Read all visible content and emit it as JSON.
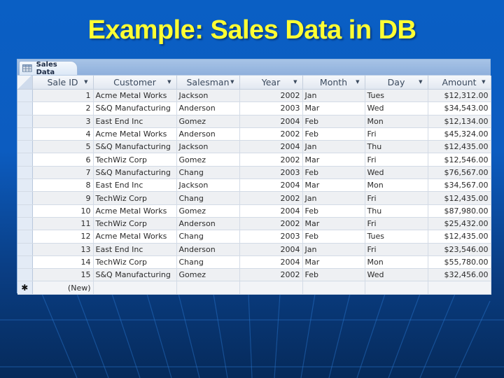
{
  "slide": {
    "title": "Example: Sales Data in DB"
  },
  "window": {
    "tab_label": "Sales Data",
    "tab_icon": "table-icon"
  },
  "table": {
    "columns": [
      {
        "label": "Sale ID"
      },
      {
        "label": "Customer"
      },
      {
        "label": "Salesman"
      },
      {
        "label": "Year"
      },
      {
        "label": "Month"
      },
      {
        "label": "Day"
      },
      {
        "label": "Amount"
      }
    ],
    "rows": [
      {
        "sale_id": "1",
        "customer": "Acme Metal Works",
        "salesman": "Jackson",
        "year": "2002",
        "month": "Jan",
        "day": "Tues",
        "amount": "$12,312.00"
      },
      {
        "sale_id": "2",
        "customer": "S&Q Manufacturing",
        "salesman": "Anderson",
        "year": "2003",
        "month": "Mar",
        "day": "Wed",
        "amount": "$34,543.00"
      },
      {
        "sale_id": "3",
        "customer": "East End Inc",
        "salesman": "Gomez",
        "year": "2004",
        "month": "Feb",
        "day": "Mon",
        "amount": "$12,134.00"
      },
      {
        "sale_id": "4",
        "customer": "Acme Metal Works",
        "salesman": "Anderson",
        "year": "2002",
        "month": "Feb",
        "day": "Fri",
        "amount": "$45,324.00"
      },
      {
        "sale_id": "5",
        "customer": "S&Q Manufacturing",
        "salesman": "Jackson",
        "year": "2004",
        "month": "Jan",
        "day": "Thu",
        "amount": "$12,435.00"
      },
      {
        "sale_id": "6",
        "customer": "TechWiz Corp",
        "salesman": "Gomez",
        "year": "2002",
        "month": "Mar",
        "day": "Fri",
        "amount": "$12,546.00"
      },
      {
        "sale_id": "7",
        "customer": "S&Q Manufacturing",
        "salesman": "Chang",
        "year": "2003",
        "month": "Feb",
        "day": "Wed",
        "amount": "$76,567.00"
      },
      {
        "sale_id": "8",
        "customer": "East End Inc",
        "salesman": "Jackson",
        "year": "2004",
        "month": "Mar",
        "day": "Mon",
        "amount": "$34,567.00"
      },
      {
        "sale_id": "9",
        "customer": "TechWiz Corp",
        "salesman": "Chang",
        "year": "2002",
        "month": "Jan",
        "day": "Fri",
        "amount": "$12,435.00"
      },
      {
        "sale_id": "10",
        "customer": "Acme Metal Works",
        "salesman": "Gomez",
        "year": "2004",
        "month": "Feb",
        "day": "Thu",
        "amount": "$87,980.00"
      },
      {
        "sale_id": "11",
        "customer": "TechWiz Corp",
        "salesman": "Anderson",
        "year": "2002",
        "month": "Mar",
        "day": "Fri",
        "amount": "$25,432.00"
      },
      {
        "sale_id": "12",
        "customer": "Acme Metal Works",
        "salesman": "Chang",
        "year": "2003",
        "month": "Feb",
        "day": "Tues",
        "amount": "$12,435.00"
      },
      {
        "sale_id": "13",
        "customer": "East End Inc",
        "salesman": "Anderson",
        "year": "2004",
        "month": "Jan",
        "day": "Fri",
        "amount": "$23,546.00"
      },
      {
        "sale_id": "14",
        "customer": "TechWiz Corp",
        "salesman": "Chang",
        "year": "2004",
        "month": "Mar",
        "day": "Mon",
        "amount": "$55,780.00"
      },
      {
        "sale_id": "15",
        "customer": "S&Q Manufacturing",
        "salesman": "Gomez",
        "year": "2002",
        "month": "Feb",
        "day": "Wed",
        "amount": "$32,456.00"
      }
    ],
    "new_row": {
      "marker": "✱",
      "label": "(New)"
    },
    "sort_arrow": "▼"
  }
}
